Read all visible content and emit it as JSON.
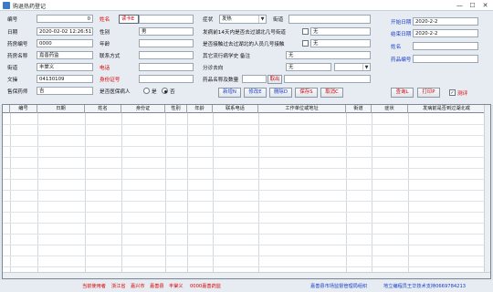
{
  "window": {
    "title": "购退热药登记",
    "min": "—",
    "max": "☐",
    "close": "✕"
  },
  "form": {
    "col1": {
      "no_label": "编号",
      "no_value": "0",
      "date_label": "日期",
      "date_value": "2020-02-02 12:26:51",
      "store_no_label": "药房编号",
      "store_no_value": "0000",
      "store_name_label": "药房名称",
      "store_name_value": "嘉善药监",
      "street_label": "街道",
      "street_value": "丰棠义",
      "user_label": "文操",
      "user_value": "04130109",
      "pharmacist_label": "售保药师",
      "pharmacist_value": "吉"
    },
    "col2": {
      "name_label": "姓名",
      "read_card_btn": "读卡E",
      "gender_label": "性别",
      "gender_value": "男",
      "age_label": "年龄",
      "contact_label": "联系方式",
      "phone_label": "电话",
      "id_label": "身份证号",
      "insurance_label": "是否医保病人",
      "radio_yes": "是",
      "radio_no": "否"
    },
    "col3": {
      "symptom_label": "症状",
      "symptom_value": "发热",
      "street_label": "街道",
      "q1_label": "发病前14天内是否去过湖北几号街道",
      "q1_value": "无",
      "q2_label": "是否接触过去过湖北的人员几号接触",
      "q2_value": "无",
      "other_label": "其它流行病学史 备注",
      "other_value": "无",
      "split_label": "分诊去向",
      "split_value": "无",
      "drug_label": "药品名称及数量",
      "drug_btn": "取出"
    },
    "right": {
      "start_label": "开始日期",
      "start_value": "2020-2-2",
      "end_label": "结束日期",
      "end_value": "2020-2-2",
      "name_label": "姓名",
      "drug_no_label": "药品编号"
    },
    "actions": {
      "new": "新增N",
      "modify": "修改E",
      "delete": "删除D",
      "save": "保存S",
      "cancel": "取消C",
      "query": "查询L",
      "print": "打印P",
      "reset_check_label": "测评"
    }
  },
  "grid": {
    "columns": [
      "编号",
      "日期",
      "姓名",
      "身份证",
      "性别",
      "年龄",
      "联系电话",
      "工作单位或地址",
      "街道",
      "症状",
      "发病前是否到过湖北或"
    ]
  },
  "status": {
    "user": "当前使用者",
    "org1": "浙江省",
    "org2": "嘉兴市",
    "org3": "嘉善县",
    "org4": "丰棠义",
    "org5": "0000嘉善药监",
    "supervisor": "嘉善县市场监督管理局组织",
    "tech": "地立编程员王华技术支持0669784213"
  }
}
